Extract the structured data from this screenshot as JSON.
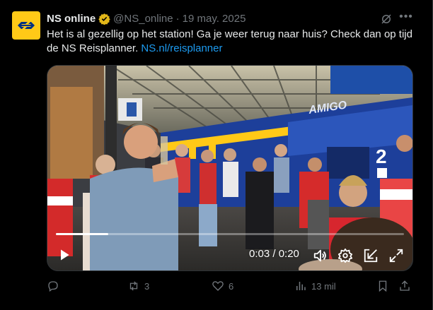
{
  "post": {
    "author_name": "NS online",
    "handle": "@NS_online",
    "separator": "·",
    "date": "19 may. 2025",
    "text": "Het is al gezellig op het station! Ga je weer terug naar huis? Check dan op tijd de NS Reisplanner. ",
    "link_text": "NS.nl/reisplanner"
  },
  "video": {
    "time_label": "0:03 / 0:20",
    "progress": 0.15,
    "train_text": "AMIGO",
    "train_number": "2"
  },
  "actions": {
    "reply_count": "",
    "repost_count": "3",
    "like_count": "6",
    "views_count": "13 mil"
  },
  "colors": {
    "brand_yellow": "#ffc917",
    "brand_blue": "#003082",
    "link": "#1d9bf0",
    "muted": "#71767b",
    "verified_gold": "#e2b719"
  },
  "icons": [
    "ns-logo-icon",
    "verified-badge-icon",
    "grok-icon",
    "more-icon",
    "play-icon",
    "volume-icon",
    "settings-icon",
    "popout-icon",
    "fullscreen-icon",
    "reply-icon",
    "repost-icon",
    "like-icon",
    "views-icon",
    "bookmark-icon",
    "share-icon"
  ]
}
